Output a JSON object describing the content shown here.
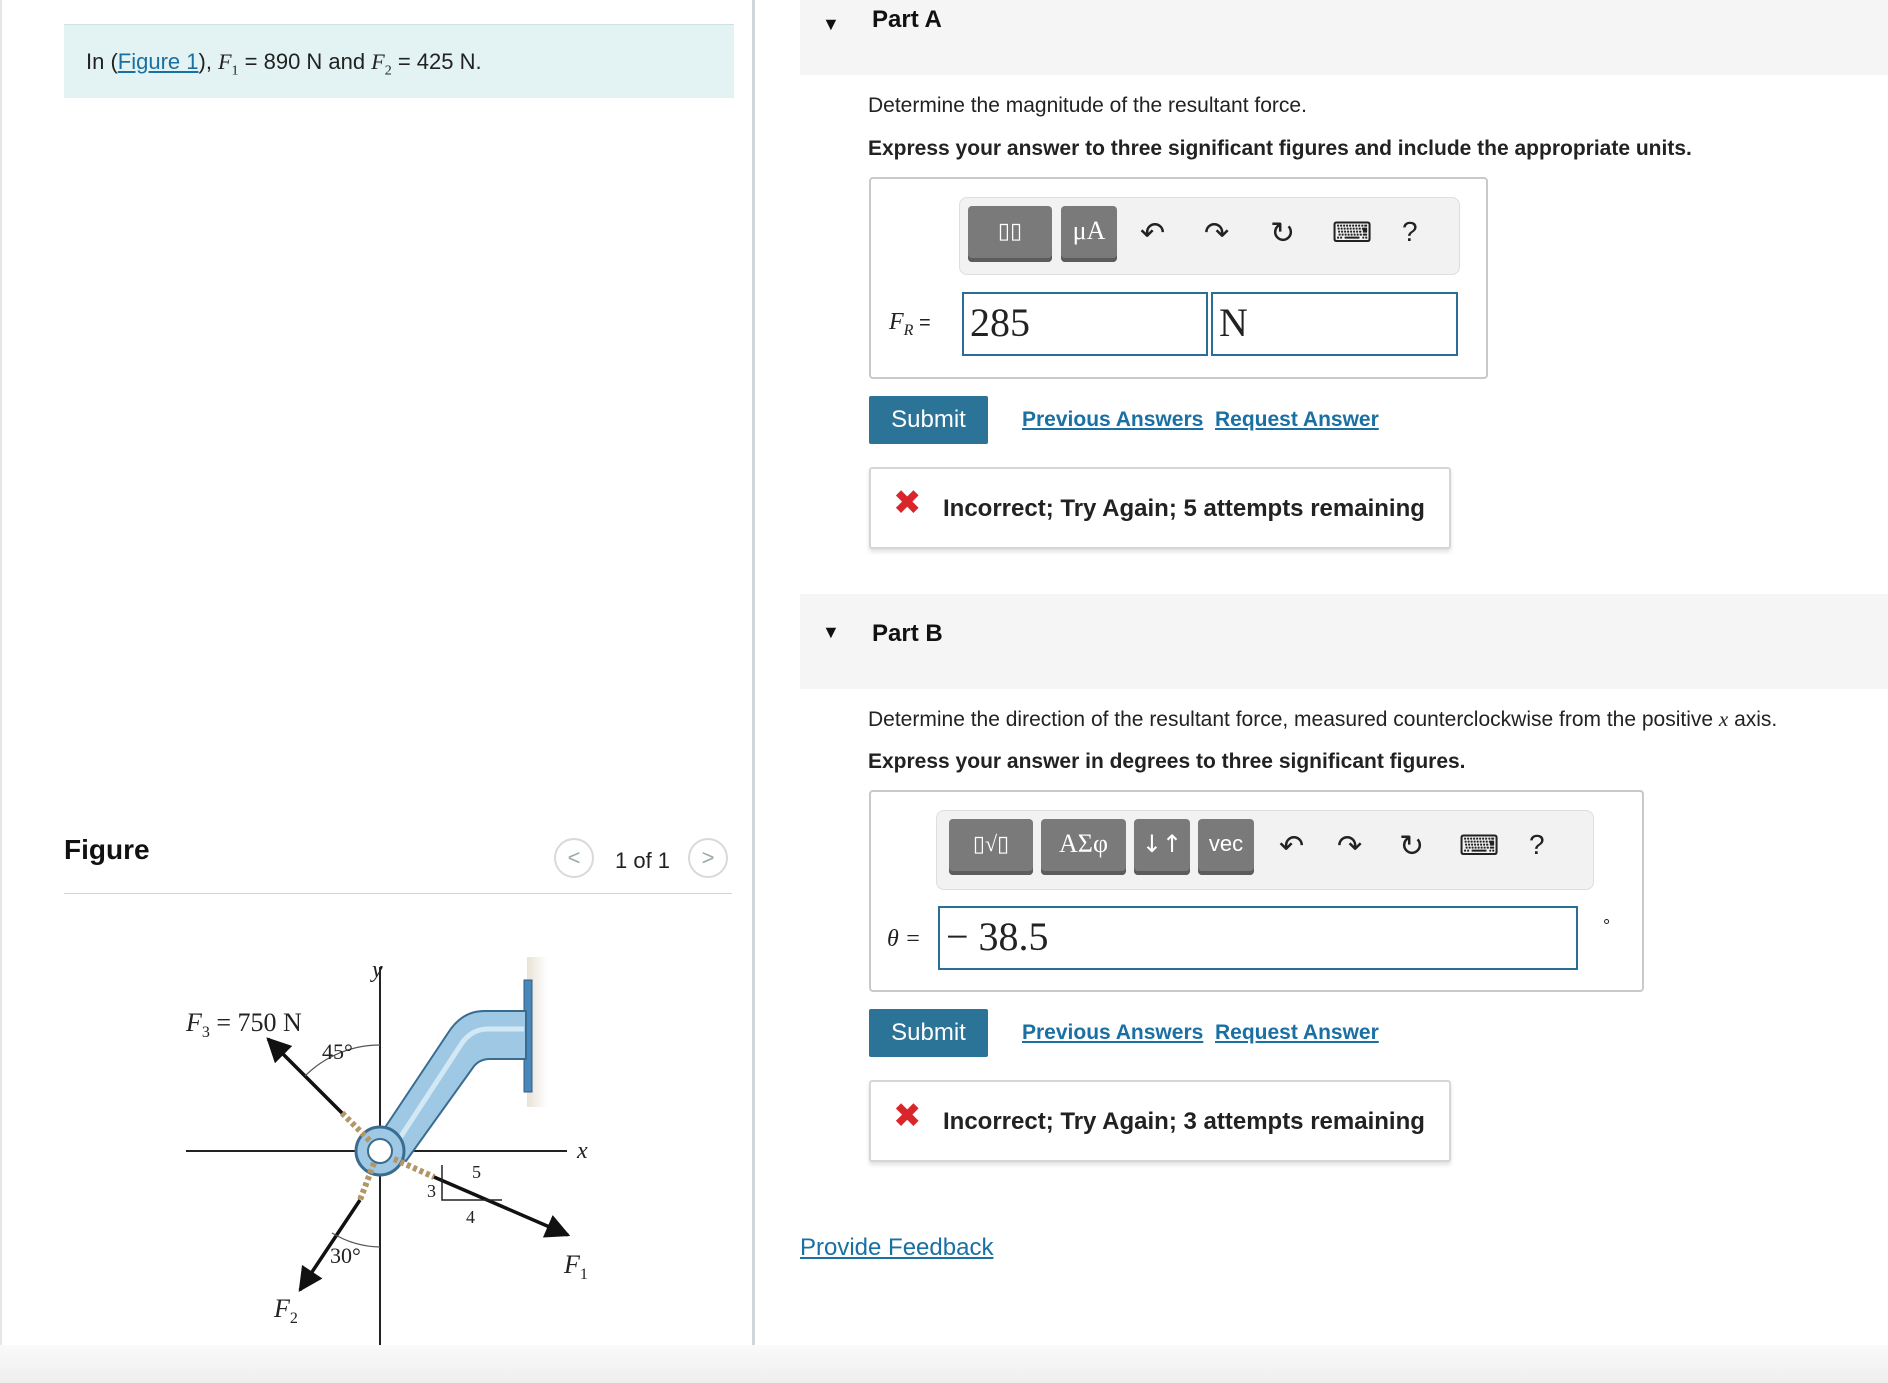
{
  "problem": {
    "prefix": "In (",
    "figure_link": "Figure 1",
    "suffix_1": "), ",
    "f1_sym": "F",
    "f1_sub": "1",
    "f1_val": " = 890 N",
    "and_text": " and ",
    "f2_sym": "F",
    "f2_sub": "2",
    "f2_val": " = 425 N."
  },
  "figure_panel": {
    "title": "Figure",
    "counter": "1 of 1",
    "prev_glyph": "<",
    "next_glyph": ">",
    "labels": {
      "y_axis": "y",
      "x_axis": "x",
      "f3": "F",
      "f3_sub": "3",
      "f3_value": " = 750 N",
      "angle_45": "45°",
      "angle_30": "30°",
      "tri_3": "3",
      "tri_4": "4",
      "tri_5": "5",
      "f1": "F",
      "f1_sub": "1",
      "f2": "F",
      "f2_sub": "2"
    }
  },
  "part_a": {
    "title": "Part A",
    "question": "Determine the magnitude of the resultant force.",
    "instruction": "Express your answer to three significant figures and include the appropriate units.",
    "toolbar": {
      "template_btn": "▯▯",
      "units_btn": "μA",
      "undo": "↶",
      "redo": "↷",
      "reset": "↻",
      "keyboard": "⌨",
      "help": "?"
    },
    "label_sym": "F",
    "label_sub": "R",
    "label_eq": " =",
    "value": "285",
    "unit": "N",
    "submit": "Submit",
    "previous_answers": "Previous Answers",
    "request_answer": "Request Answer",
    "feedback": "Incorrect; Try Again; 5 attempts remaining",
    "feedback_icon": "✖"
  },
  "part_b": {
    "title": "Part B",
    "question_prefix": "Determine the direction of the resultant force, measured counterclockwise from the positive ",
    "question_var": "x",
    "question_suffix": " axis.",
    "instruction": "Express your answer in degrees to three significant figures.",
    "toolbar": {
      "template_btn": "▯√▯",
      "greek_btn": "ΑΣφ",
      "arrows_btn": "↓↑",
      "vec_btn": "vec",
      "undo": "↶",
      "redo": "↷",
      "reset": "↻",
      "keyboard": "⌨",
      "help": "?"
    },
    "label": "θ =",
    "value": "− 38.5",
    "unit": "°",
    "submit": "Submit",
    "previous_answers": "Previous Answers",
    "request_answer": "Request Answer",
    "feedback": "Incorrect; Try Again; 3 attempts remaining",
    "feedback_icon": "✖"
  },
  "provide_feedback": "Provide Feedback",
  "colors": {
    "accent": "#2c7398",
    "link": "#1a6fa3",
    "error": "#d9262c",
    "problem_bg": "#e3f3f3",
    "pipe": "#9ec8e4"
  }
}
